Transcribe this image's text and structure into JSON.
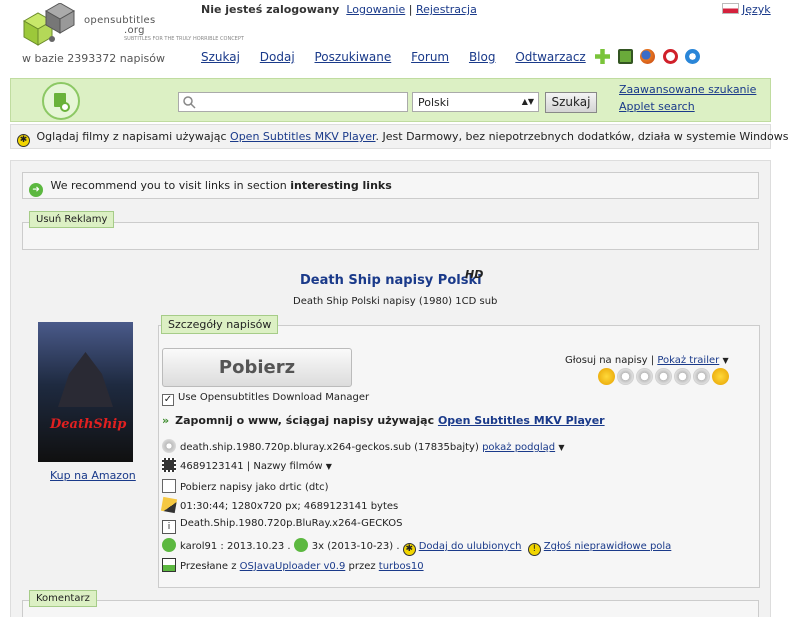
{
  "header": {
    "logo_text": "opensubtitles",
    "logo_domain": ".org",
    "logo_tagline": "SUBTITLES FOR THE TRULY HORRIBLE CONCEPT",
    "subtitle_count": "w bazie 2393372 napisów",
    "login_status": "Nie jesteś zalogowany",
    "login_link": "Logowanie",
    "separator": "|",
    "register_link": "Rejestracja",
    "language_link": "Język"
  },
  "menu": [
    "Szukaj",
    "Dodaj",
    "Poszukiwane",
    "Forum",
    "Blog",
    "Odtwarzacz"
  ],
  "toolbar_icons": [
    "plus-star-icon",
    "cube-icon",
    "firefox-icon",
    "opera-icon",
    "ie-icon"
  ],
  "search": {
    "placeholder": "",
    "language_value": "Polski",
    "button_label": "Szukaj",
    "advanced_link": "Zaawansowane szukanie",
    "applet_link": "Applet search"
  },
  "mkv_bar": {
    "text_before": "Oglądaj filmy z napisami używając",
    "link": "Open Subtitles MKV Player",
    "text_after": ". Jest Darmowy, bez niepotrzebnych dodatków, działa w systemie Windows."
  },
  "recommend": {
    "text": "We recommend you to visit links in section",
    "bold": "interesting links"
  },
  "ads_tag": "Usuń Reklamy",
  "movie": {
    "title": "Death Ship napisy Polski",
    "hd": "HD",
    "subtitle": "Death Ship Polski napisy (1980) 1CD sub",
    "poster_title": "DeathShip",
    "amazon_link": "Kup na Amazon"
  },
  "details": {
    "tag": "Szczegóły napisów",
    "download_button": "Pobierz",
    "manager_checkbox": "Use Opensubtitles Download Manager",
    "vote_label": "Głosuj na napisy",
    "trailer_link": "Pokaż trailer",
    "mkv_text": "Zapomnij o www, ściągaj napisy używając",
    "mkv_link": "Open Subtitles MKV Player",
    "file_name": "death.ship.1980.720p.bluray.x264-geckos.sub (17835bajty)",
    "preview_link": "pokaż podgląd",
    "hash_id": "4689123141",
    "names_dropdown": "Nazwy filmów",
    "download_dtc": "Pobierz napisy jako drtic (dtc)",
    "video_info": "01:30:44; 1280x720 px; 4689123141 bytes",
    "release_name": "Death.Ship.1980.720p.BluRay.x264-GECKOS",
    "uploader_info": "karol91 : 2013.10.23 .",
    "downloads_info": "3x (2013-10-23) .",
    "favorite_link": "Dodaj do ulubionych",
    "report_link": "Zgłoś nieprawidłowe pola",
    "sent_text": "Przesłane z",
    "sent_tool_link": "OSJavaUploader v0.9",
    "via_text": "przez",
    "via_user_link": "turbos10"
  },
  "comments_tag": "Komentarz",
  "colors": {
    "accent_green": "#dcf0c4",
    "link_blue": "#1a3a8a"
  }
}
